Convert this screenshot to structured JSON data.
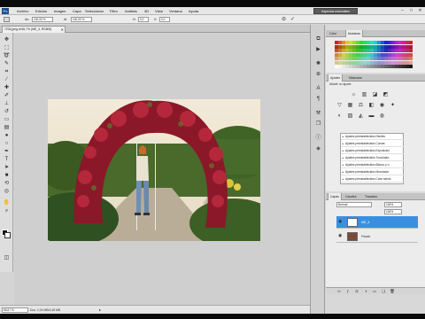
{
  "app": {
    "logo_text": "Ps",
    "menu": [
      "Archivo",
      "Edición",
      "Imagen",
      "Capa",
      "Seleccionar",
      "Filtro",
      "Análisis",
      "3D",
      "Vista",
      "Ventana",
      "Ayuda"
    ],
    "workspace_button": "Aspectos esenciales",
    "window_controls": [
      "–",
      "□",
      "✕"
    ]
  },
  "options_bar": {
    "fields": [
      "100,00 %",
      "100,00 %",
      "0,0",
      "0,0"
    ],
    "labels": [
      "An:",
      "Al:",
      "H:",
      "V:"
    ],
    "commit_icon": "check-icon",
    "cancel_icon": "cancel-icon"
  },
  "document": {
    "tab_title": "7234.jpeg al 66,7% (ME_4, RGB/8)",
    "tab_close": "✕",
    "zoom": "66,67 %",
    "status_info": "Doc: 2,24 MB/4,48 MB",
    "status_arrow": "▸"
  },
  "panels": {
    "color_tabs": [
      "Color",
      "Muestras"
    ],
    "adjust_tabs": [
      "Ajustes",
      "Máscaras"
    ],
    "adjust_title": "Añadir un ajuste",
    "presets": [
      "Ajustes preestablecidos Niveles",
      "Ajustes preestablecidos Curvas",
      "Ajustes preestablecidos Exposición",
      "Ajustes preestablecidos Tono/satur.",
      "Ajustes preestablecidos Blanco y n.",
      "Ajustes preestablecidos Mezclador",
      "Ajustes preestablecidos Color select."
    ],
    "layer_tabs": [
      "Capas",
      "Canales",
      "Trazados"
    ],
    "blend_mode": "Normal",
    "opacity": "100%",
    "fill": "100%",
    "layers": [
      {
        "name": "ME_4",
        "selected": true
      },
      {
        "name": "Fondo",
        "selected": false
      }
    ]
  },
  "colors": {
    "accent_selected_layer": "#3b8fe0",
    "workspace_bg": "#cfcfcf"
  },
  "icons": {
    "tools": [
      "move-icon",
      "marquee-icon",
      "lasso-icon",
      "quick-select-icon",
      "crop-icon",
      "eyedropper-icon",
      "healing-icon",
      "brush-icon",
      "stamp-icon",
      "history-brush-icon",
      "eraser-icon",
      "gradient-icon",
      "blur-icon",
      "dodge-icon",
      "pen-icon",
      "type-icon",
      "path-select-icon",
      "shape-icon",
      "3d-rotate-icon",
      "3d-orbit-icon",
      "hand-icon",
      "zoom-icon"
    ],
    "dock": [
      "history-icon",
      "actions-icon",
      "brushes-icon",
      "clone-source-icon",
      "character-icon",
      "paragraph-icon",
      "tool-presets-icon",
      "layer-comps-icon"
    ]
  }
}
